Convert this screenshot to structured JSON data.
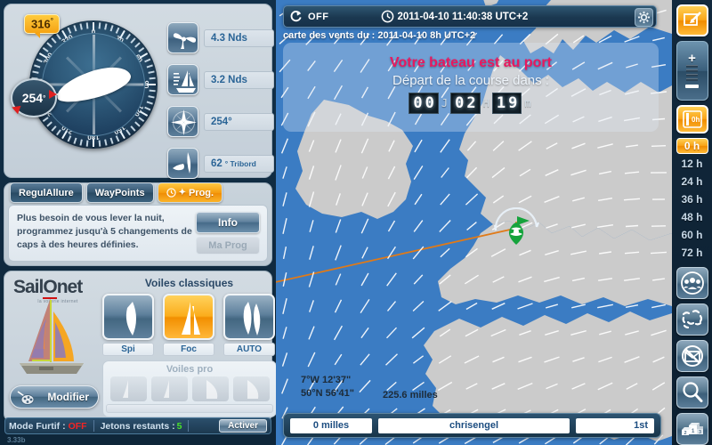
{
  "instruments": {
    "compass": {
      "heading_badge": "254",
      "heading_badge_unit": "°",
      "wind_badge": "316",
      "wind_badge_unit": "°",
      "tick_labels": [
        "0",
        "30",
        "60",
        "90",
        "120",
        "150",
        "180",
        "210",
        "240",
        "270",
        "300",
        "330"
      ]
    },
    "rows": [
      {
        "icon": "anemometer-icon",
        "value": "4.3 Nds"
      },
      {
        "icon": "boat-speed-icon",
        "value": "3.2 Nds"
      },
      {
        "icon": "compass-rose-icon",
        "value": "254°"
      },
      {
        "icon": "wind-angle-icon",
        "value": "62",
        "unit": "° Tribord"
      }
    ]
  },
  "prog": {
    "tabs": [
      {
        "label": "RegulAllure",
        "active": false
      },
      {
        "label": "WayPoints",
        "active": false
      },
      {
        "label": "Prog.",
        "active": true
      }
    ],
    "description": "Plus besoin de vous lever la nuit, programmez jusqu'à 5 changements de caps à des heures définies.",
    "info_label": "Info",
    "maprog_label": "Ma Prog"
  },
  "sails": {
    "brand": "Sail",
    "brand_o": "O",
    "brand_end": "net",
    "tagline": "la voilerie internet",
    "modifier_label": "Modifier",
    "title": "Voiles classiques",
    "options": [
      {
        "label": "Spi",
        "selected": false
      },
      {
        "label": "Foc",
        "selected": true
      },
      {
        "label": "AUTO",
        "selected": false
      }
    ],
    "pro_title": "Voiles pro",
    "pro_count": 4
  },
  "status_bar": {
    "furtif_label": "Mode Furtif :",
    "furtif_value": "OFF",
    "jetons_label": "Jetons restants :",
    "jetons_value": "5",
    "activer_label": "Activer",
    "version": "3.33b"
  },
  "map": {
    "header": {
      "refresh_state": "OFF",
      "datetime": "2011-04-10 11:40:38 UTC+2",
      "gear_icon": "gear-icon"
    },
    "wind_caption": "carte des vents du : 2011-04-10 8h UTC+2",
    "message": {
      "line1": "Votre bateau est au port",
      "line2": "Départ de la course dans :"
    },
    "countdown": {
      "days": "00",
      "days_unit": "J",
      "hours": "02",
      "hours_unit": "H",
      "minutes": "19",
      "minutes_unit": "m"
    },
    "coords_lon": "7°W 12'37\"",
    "coords_lat": "50°N 56'41\"",
    "distance_to_mark": "225.6 milles",
    "footer": {
      "distance_sailed": "0 milles",
      "player_name": "chrisengel",
      "rank": "1st"
    },
    "colors": {
      "sea": "#3b7cc3",
      "land": "#cbcbcb",
      "route": "#e07a18",
      "boat": "#15a33c"
    }
  },
  "toolbar": {
    "collapse_icon": "collapse-arrow-icon",
    "zoom": {
      "plus": "+",
      "minus": "−"
    },
    "forecast_icon": "forecast-slider-icon",
    "hours": [
      {
        "label": "0 h",
        "active": true
      },
      {
        "label": "12 h",
        "active": false
      },
      {
        "label": "24 h",
        "active": false
      },
      {
        "label": "36 h",
        "active": false
      },
      {
        "label": "48 h",
        "active": false
      },
      {
        "label": "60 h",
        "active": false
      },
      {
        "label": "72 h",
        "active": false
      }
    ],
    "buttons": [
      {
        "icon": "fleet-players-icon"
      },
      {
        "icon": "trajectories-icon"
      },
      {
        "icon": "no-message-icon"
      },
      {
        "icon": "search-icon"
      },
      {
        "icon": "ranking-podium-icon"
      }
    ]
  }
}
